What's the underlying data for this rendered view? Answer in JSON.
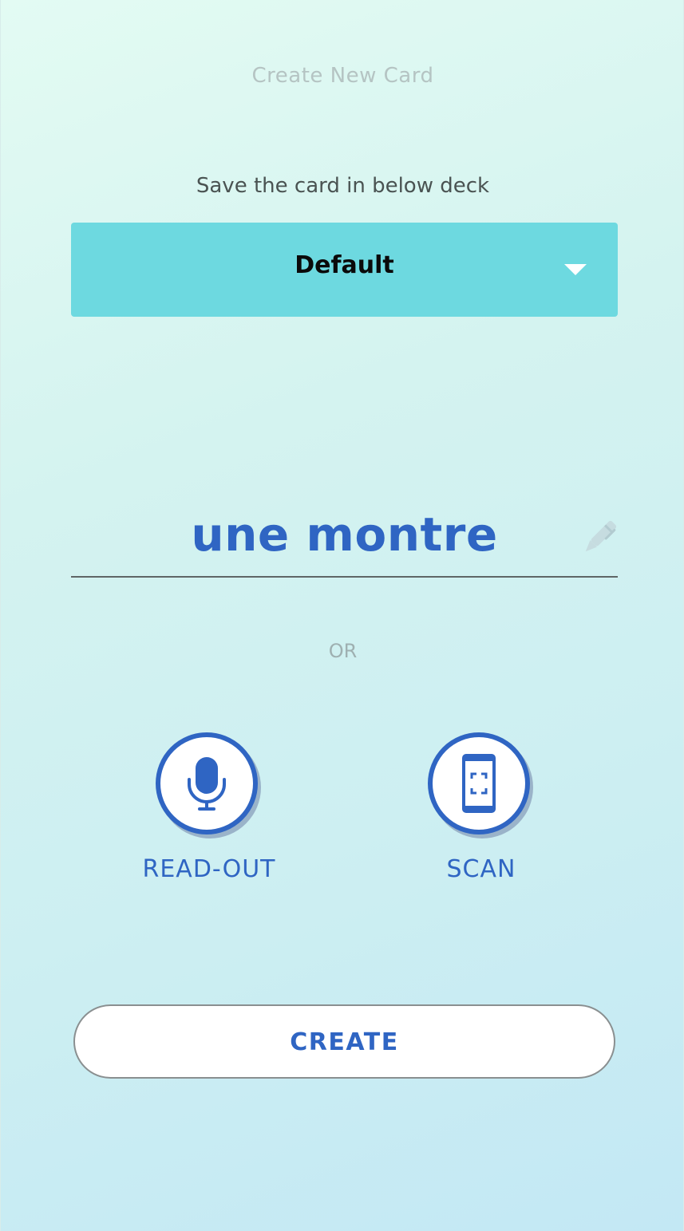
{
  "screen": {
    "title": "Create New Card"
  },
  "deck": {
    "label": "Save the card in below deck",
    "selected": "Default"
  },
  "word_input": {
    "value": "une montre"
  },
  "divider": {
    "text": "OR"
  },
  "actions": {
    "read_out_label": "READ-OUT",
    "scan_label": "SCAN"
  },
  "footer": {
    "create_label": "CREATE"
  },
  "colors": {
    "accent_blue": "#2f65c3",
    "dropdown_bg": "#6dd9e0",
    "background_top": "#e3fbf3",
    "background_bottom": "#c3e8f4"
  },
  "icons": [
    "chevron-down-icon",
    "pencil-icon",
    "microphone-icon",
    "phone-scan-icon"
  ]
}
